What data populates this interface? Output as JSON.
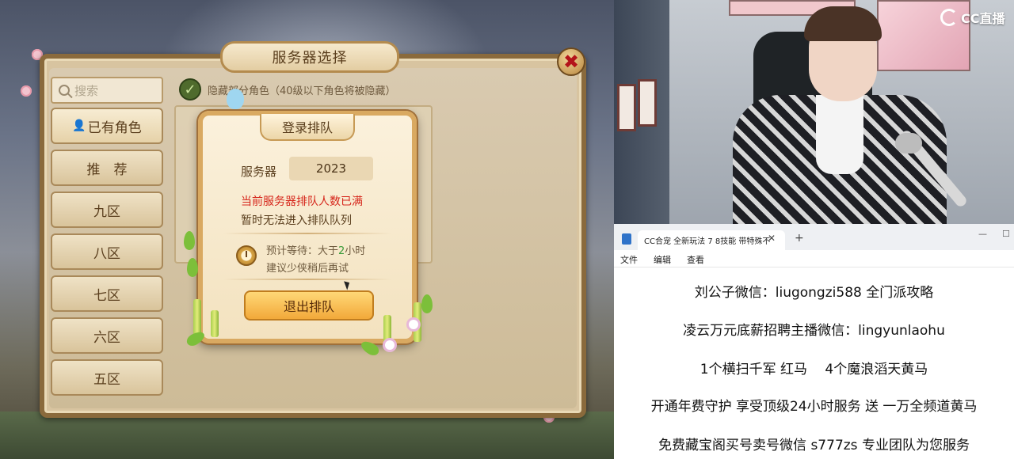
{
  "game": {
    "panel_title": "服务器选择",
    "close_label": "✖",
    "search_placeholder": "搜索",
    "checkbox_label": "隐藏部分角色（40级以下角色将被隐藏）",
    "side_buttons": [
      "已有角色",
      "推　荐",
      "九区",
      "八区",
      "七区",
      "六区",
      "五区"
    ],
    "dialog": {
      "title": "登录排队",
      "server_label": "服务器",
      "server_value": "2023",
      "warning_line1": "当前服务器排队人数已满",
      "warning_line2": "暂时无法进入排队队列",
      "wait_prefix": "预计等待：大于",
      "wait_hours": "2",
      "wait_suffix": "小时",
      "advice": "建议少侠稍后再试",
      "exit_button": "退出排队"
    }
  },
  "camera": {
    "logo_text": "CC直播"
  },
  "notepad": {
    "tab_title": "CC合宠 全新玩法 7 8技能 带特殊不",
    "tab_close": "✕",
    "new_tab": "+",
    "window_controls": [
      "—",
      "☐"
    ],
    "menu": [
      "文件",
      "编辑",
      "查看"
    ],
    "lines": [
      "刘公子微信：liugongzi588 全门派攻略",
      "凌云万元底薪招聘主播微信：lingyunlaohu",
      "1个横扫千军 红马　 4个魔浪滔天黄马",
      "开通年费守护 享受顶级24小时服务 送 一万全频道黄马",
      "免费藏宝阁买号卖号微信 s777zs 专业团队为您服务"
    ]
  },
  "colors": {
    "warning_red": "#d6261b",
    "wait_green": "#3a9b3a",
    "exit_button": "#f2a93a"
  }
}
